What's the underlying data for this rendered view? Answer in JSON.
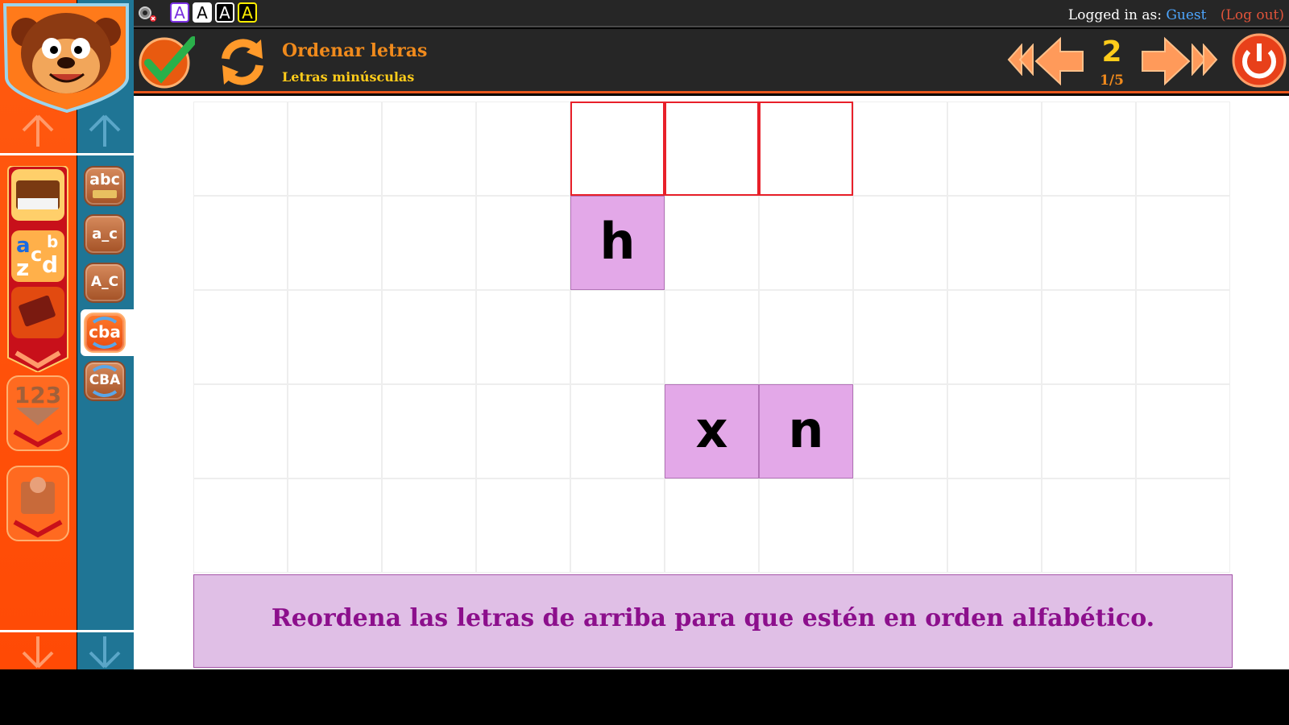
{
  "topbar": {
    "font_buttons": [
      "A",
      "A",
      "A",
      "A"
    ],
    "login_label": "Logged in as:",
    "user": "Guest",
    "logout": "(Log out)"
  },
  "header": {
    "title": "Ordenar letras",
    "subtitle": "Letras minúsculas",
    "activity_number": "2",
    "activity_count": "1/5"
  },
  "sidebar": {
    "categories": [
      "books-category",
      "letters-category",
      "reading-category",
      "numbers-category",
      "fun-category"
    ],
    "subcategories": [
      {
        "label": "abc",
        "icon": "alphabet-book-icon"
      },
      {
        "label": "a_c",
        "icon": "lowercase-gap-icon"
      },
      {
        "label": "A_C",
        "icon": "uppercase-gap-icon"
      },
      {
        "label": "cba",
        "icon": "lowercase-order-icon",
        "active": true
      },
      {
        "label": "CBA",
        "icon": "uppercase-order-icon"
      }
    ]
  },
  "board": {
    "slots": 3,
    "tiles": [
      "h",
      "x",
      "n"
    ]
  },
  "message": "Reordena las letras de arriba para que estén en orden alfabético.",
  "colors": {
    "accent": "#ff4a05",
    "sidebar_blue": "#1f7595",
    "tile": "#e3a8e8",
    "slot_border": "#e8202a",
    "message_text": "#8c0f8c"
  }
}
